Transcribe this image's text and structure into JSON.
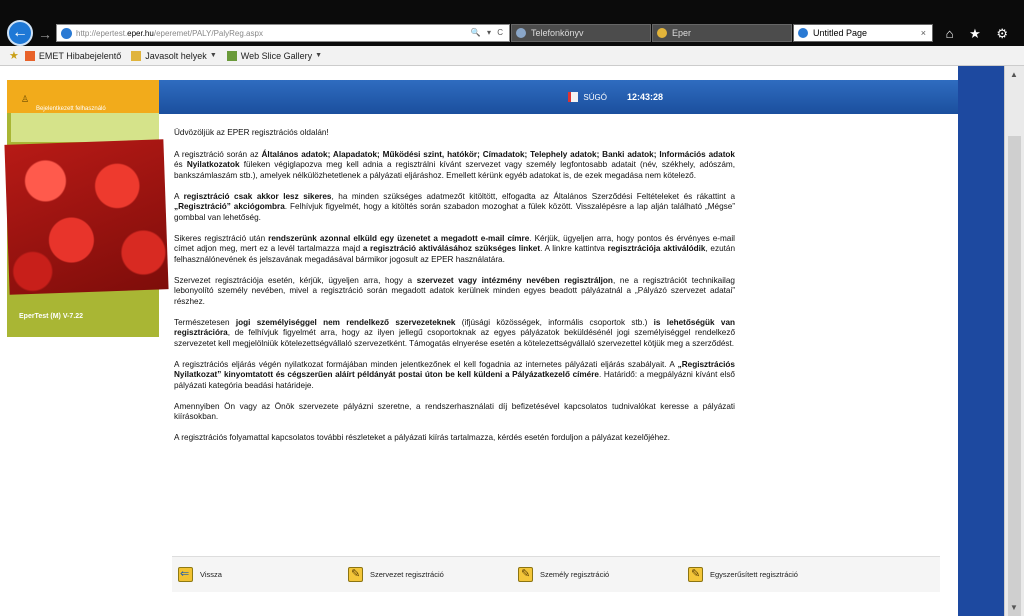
{
  "browser": {
    "url_prefix": "http://epertest.",
    "url_host": "eper.hu",
    "url_path": "/eperemet/PALY/PalyReg.aspx",
    "address_tools": "🔍 ▾ C",
    "tabs": [
      {
        "label": "Telefonkönyv"
      },
      {
        "label": "Eper"
      },
      {
        "label": "Untitled Page"
      }
    ],
    "tab_close": "×",
    "toolbar_icons": "⌂ ★ ⚙"
  },
  "favorites": {
    "star": "★",
    "items": [
      {
        "label": "EMET Hibabejelentő"
      },
      {
        "label": "Javasolt helyek"
      },
      {
        "label": "Web Slice Gallery"
      }
    ]
  },
  "sidebar": {
    "user_label": "Bejelentkezett felhasználó",
    "version": "EperTest (M) V-7.22"
  },
  "header": {
    "help_label": "SÚGÓ",
    "time": "12:43:28"
  },
  "content": {
    "welcome": "Üdvözöljük az EPER regisztrációs oldalán!",
    "p1": {
      "t1": "A regisztráció során az ",
      "b1": "Általános adatok; Alapadatok; Működési szint, hatókör; Címadatok; Telephely adatok; Banki adatok; Információs adatok",
      "t2": " és ",
      "b2": "Nyilatkozatok",
      "t3": " füleken végiglapozva meg kell adnia a regisztrálni kívánt szervezet vagy személy legfontosabb adatait (név, székhely, adószám, bankszámlaszám stb.), amelyek nélkülözhetetlenek a pályázati eljáráshoz. Emellett kérünk egyéb adatokat is, de ezek megadása nem kötelező."
    },
    "p2": {
      "t1": "A ",
      "b1": "regisztráció csak akkor lesz sikeres",
      "t2": ", ha minden szükséges adatmezőt kitöltött, elfogadta az Általános Szerződési Feltételeket és rákattint a ",
      "b2": "„Regisztráció” akciógombra",
      "t3": ". Felhívjuk figyelmét, hogy a kitöltés során szabadon mozoghat a fülek között. Visszalépésre a lap alján található „Mégse” gombbal van lehetőség."
    },
    "p3": {
      "t1": "Sikeres regisztráció után ",
      "b1": "rendszerünk azonnal elküld egy üzenetet a megadott e-mail címre",
      "t2": ". Kérjük, ügyeljen arra, hogy pontos és érvényes e-mail címet adjon meg, mert ez a levél tartalmazza majd ",
      "b2": "a regisztráció aktiválásához szükséges linket",
      "t3": ". A linkre kattintva ",
      "b3": "regisztrációja aktiválódik",
      "t4": ", ezután felhasználónevének és jelszavának megadásával bármikor jogosult az EPER használatára."
    },
    "p4": {
      "t1": "Szervezet regisztrációja esetén, kérjük, ügyeljen arra, hogy a ",
      "b1": "szervezet vagy intézmény nevében regisztráljon",
      "t2": ", ne a regisztrációt technikailag lebonyolító személy nevében, mivel a regisztráció során megadott adatok kerülnek minden egyes beadott pályázatnál a „Pályázó szervezet adatai” részhez."
    },
    "p5": {
      "t1": "Természetesen ",
      "b1": "jogi személyiséggel nem rendelkező szervezeteknek",
      "t2": " (ifjúsági közösségek, informális csoportok stb.) ",
      "b2": "is lehetőségük van regisztrációra",
      "t3": ", de felhívjuk figyelmét arra, hogy az ilyen jellegű csoportoknak az egyes pályázatok beküldésénél jogi személyiséggel rendelkező szervezetet kell megjelölniük kötelezettségvállaló szervezetként. Támogatás elnyerése esetén a kötelezettségvállaló szervezettel kötjük meg a szerződést."
    },
    "p6": {
      "t1": "A regisztrációs eljárás végén nyilatkozat formájában minden jelentkezőnek el kell fogadnia az internetes pályázati eljárás szabályait. A ",
      "b1": "„Regisztrációs Nyilatkozat” kinyomtatott és cégszerűen aláírt példányát postai úton be kell küldeni a Pályázatkezelő címére",
      "t2": ". Határidő: a megpályázni kívánt első pályázati kategória beadási határideje."
    },
    "p7": "Amennyiben Ön vagy az Önök szervezete pályázni szeretne, a rendszerhasználati díj befizetésével kapcsolatos tudnivalókat keresse a pályázati kiírásokban.",
    "p8": "A regisztrációs folyamattal kapcsolatos további részleteket a pályázati kiírás tartalmazza, kérdés esetén forduljon a pályázat kezelőjéhez."
  },
  "footer": {
    "back": "Vissza",
    "org_reg": "Szervezet regisztráció",
    "person_reg": "Személy regisztráció",
    "simple_reg": "Egyszerűsített regisztráció"
  },
  "colors": {
    "header_blue": "#1d49a0",
    "sidebar_green": "#a9b634",
    "sidebar_orange": "#f2ab1b"
  }
}
